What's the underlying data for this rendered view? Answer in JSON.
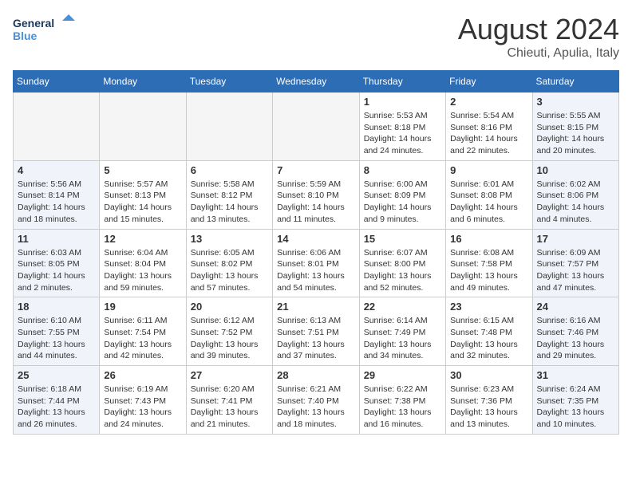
{
  "header": {
    "logo_line1": "General",
    "logo_line2": "Blue",
    "month": "August 2024",
    "location": "Chieuti, Apulia, Italy"
  },
  "weekdays": [
    "Sunday",
    "Monday",
    "Tuesday",
    "Wednesday",
    "Thursday",
    "Friday",
    "Saturday"
  ],
  "weeks": [
    [
      {
        "day": "",
        "info": ""
      },
      {
        "day": "",
        "info": ""
      },
      {
        "day": "",
        "info": ""
      },
      {
        "day": "",
        "info": ""
      },
      {
        "day": "1",
        "info": "Sunrise: 5:53 AM\nSunset: 8:18 PM\nDaylight: 14 hours\nand 24 minutes."
      },
      {
        "day": "2",
        "info": "Sunrise: 5:54 AM\nSunset: 8:16 PM\nDaylight: 14 hours\nand 22 minutes."
      },
      {
        "day": "3",
        "info": "Sunrise: 5:55 AM\nSunset: 8:15 PM\nDaylight: 14 hours\nand 20 minutes."
      }
    ],
    [
      {
        "day": "4",
        "info": "Sunrise: 5:56 AM\nSunset: 8:14 PM\nDaylight: 14 hours\nand 18 minutes."
      },
      {
        "day": "5",
        "info": "Sunrise: 5:57 AM\nSunset: 8:13 PM\nDaylight: 14 hours\nand 15 minutes."
      },
      {
        "day": "6",
        "info": "Sunrise: 5:58 AM\nSunset: 8:12 PM\nDaylight: 14 hours\nand 13 minutes."
      },
      {
        "day": "7",
        "info": "Sunrise: 5:59 AM\nSunset: 8:10 PM\nDaylight: 14 hours\nand 11 minutes."
      },
      {
        "day": "8",
        "info": "Sunrise: 6:00 AM\nSunset: 8:09 PM\nDaylight: 14 hours\nand 9 minutes."
      },
      {
        "day": "9",
        "info": "Sunrise: 6:01 AM\nSunset: 8:08 PM\nDaylight: 14 hours\nand 6 minutes."
      },
      {
        "day": "10",
        "info": "Sunrise: 6:02 AM\nSunset: 8:06 PM\nDaylight: 14 hours\nand 4 minutes."
      }
    ],
    [
      {
        "day": "11",
        "info": "Sunrise: 6:03 AM\nSunset: 8:05 PM\nDaylight: 14 hours\nand 2 minutes."
      },
      {
        "day": "12",
        "info": "Sunrise: 6:04 AM\nSunset: 8:04 PM\nDaylight: 13 hours\nand 59 minutes."
      },
      {
        "day": "13",
        "info": "Sunrise: 6:05 AM\nSunset: 8:02 PM\nDaylight: 13 hours\nand 57 minutes."
      },
      {
        "day": "14",
        "info": "Sunrise: 6:06 AM\nSunset: 8:01 PM\nDaylight: 13 hours\nand 54 minutes."
      },
      {
        "day": "15",
        "info": "Sunrise: 6:07 AM\nSunset: 8:00 PM\nDaylight: 13 hours\nand 52 minutes."
      },
      {
        "day": "16",
        "info": "Sunrise: 6:08 AM\nSunset: 7:58 PM\nDaylight: 13 hours\nand 49 minutes."
      },
      {
        "day": "17",
        "info": "Sunrise: 6:09 AM\nSunset: 7:57 PM\nDaylight: 13 hours\nand 47 minutes."
      }
    ],
    [
      {
        "day": "18",
        "info": "Sunrise: 6:10 AM\nSunset: 7:55 PM\nDaylight: 13 hours\nand 44 minutes."
      },
      {
        "day": "19",
        "info": "Sunrise: 6:11 AM\nSunset: 7:54 PM\nDaylight: 13 hours\nand 42 minutes."
      },
      {
        "day": "20",
        "info": "Sunrise: 6:12 AM\nSunset: 7:52 PM\nDaylight: 13 hours\nand 39 minutes."
      },
      {
        "day": "21",
        "info": "Sunrise: 6:13 AM\nSunset: 7:51 PM\nDaylight: 13 hours\nand 37 minutes."
      },
      {
        "day": "22",
        "info": "Sunrise: 6:14 AM\nSunset: 7:49 PM\nDaylight: 13 hours\nand 34 minutes."
      },
      {
        "day": "23",
        "info": "Sunrise: 6:15 AM\nSunset: 7:48 PM\nDaylight: 13 hours\nand 32 minutes."
      },
      {
        "day": "24",
        "info": "Sunrise: 6:16 AM\nSunset: 7:46 PM\nDaylight: 13 hours\nand 29 minutes."
      }
    ],
    [
      {
        "day": "25",
        "info": "Sunrise: 6:18 AM\nSunset: 7:44 PM\nDaylight: 13 hours\nand 26 minutes."
      },
      {
        "day": "26",
        "info": "Sunrise: 6:19 AM\nSunset: 7:43 PM\nDaylight: 13 hours\nand 24 minutes."
      },
      {
        "day": "27",
        "info": "Sunrise: 6:20 AM\nSunset: 7:41 PM\nDaylight: 13 hours\nand 21 minutes."
      },
      {
        "day": "28",
        "info": "Sunrise: 6:21 AM\nSunset: 7:40 PM\nDaylight: 13 hours\nand 18 minutes."
      },
      {
        "day": "29",
        "info": "Sunrise: 6:22 AM\nSunset: 7:38 PM\nDaylight: 13 hours\nand 16 minutes."
      },
      {
        "day": "30",
        "info": "Sunrise: 6:23 AM\nSunset: 7:36 PM\nDaylight: 13 hours\nand 13 minutes."
      },
      {
        "day": "31",
        "info": "Sunrise: 6:24 AM\nSunset: 7:35 PM\nDaylight: 13 hours\nand 10 minutes."
      }
    ]
  ]
}
